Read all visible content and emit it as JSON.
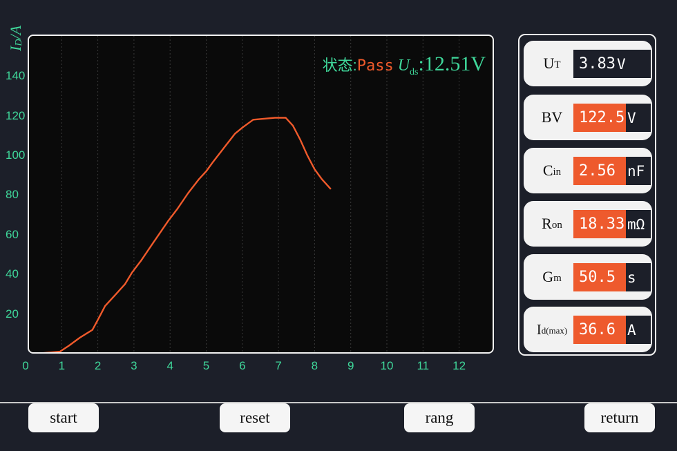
{
  "chart_data": {
    "type": "line",
    "ylabel": "I",
    "ylabel_sub": "D",
    "ylabel_unit": "/A",
    "xlim": [
      0,
      12.9
    ],
    "ylim": [
      0,
      150
    ],
    "x_ticks": [
      "0",
      "1",
      "2",
      "3",
      "4",
      "5",
      "6",
      "7",
      "8",
      "9",
      "10",
      "11",
      "12"
    ],
    "y_ticks": [
      20,
      40,
      60,
      80,
      100,
      120,
      140
    ],
    "grid": "vertical dotted",
    "series": [
      {
        "color": "#f05a2b",
        "x": [
          0.3,
          0.95,
          1.2,
          1.5,
          1.85,
          2.0,
          2.2,
          2.5,
          2.75,
          2.95,
          3.2,
          3.5,
          3.8,
          3.95,
          4.2,
          4.5,
          4.8,
          5.0,
          5.2,
          5.5,
          5.8,
          6.0,
          6.3,
          6.6,
          6.9,
          7.2,
          7.4,
          7.6,
          7.8,
          8.0,
          8.2,
          8.45
        ],
        "y": [
          0,
          1,
          4,
          8,
          12,
          17,
          24,
          30,
          35,
          41,
          47,
          55,
          63,
          67,
          73,
          81,
          88,
          92,
          97,
          104,
          111,
          114,
          118,
          118.5,
          119,
          119,
          115,
          108,
          100,
          93,
          88,
          83
        ]
      }
    ]
  },
  "status": {
    "label": "状态:",
    "value": "Pass",
    "uds_symbol": "U",
    "uds_sub": "ds",
    "uds_value": ":12.51V"
  },
  "params": [
    {
      "name": "U",
      "sub": "T",
      "value": "3.83",
      "unit": "V",
      "highlight": false
    },
    {
      "name": "BV",
      "sub": "",
      "value": "122.5",
      "unit": "V",
      "highlight": true
    },
    {
      "name": "C",
      "sub": "in",
      "value": "2.56",
      "unit": "nF",
      "highlight": true
    },
    {
      "name": "R",
      "sub": "on",
      "value": "18.33",
      "unit": "mΩ",
      "highlight": true
    },
    {
      "name": "G",
      "sub": "m",
      "value": "50.5",
      "unit": "s",
      "highlight": true
    },
    {
      "name": "I",
      "sub": "d(max)",
      "value": "36.6",
      "unit": "A",
      "highlight": true
    }
  ],
  "buttons": {
    "start": "start",
    "reset": "reset",
    "rang": "rang",
    "return": "return"
  },
  "colors": {
    "accent_green": "#3fd79a",
    "accent_orange": "#ee5a2d",
    "background": "#1c1f29"
  }
}
